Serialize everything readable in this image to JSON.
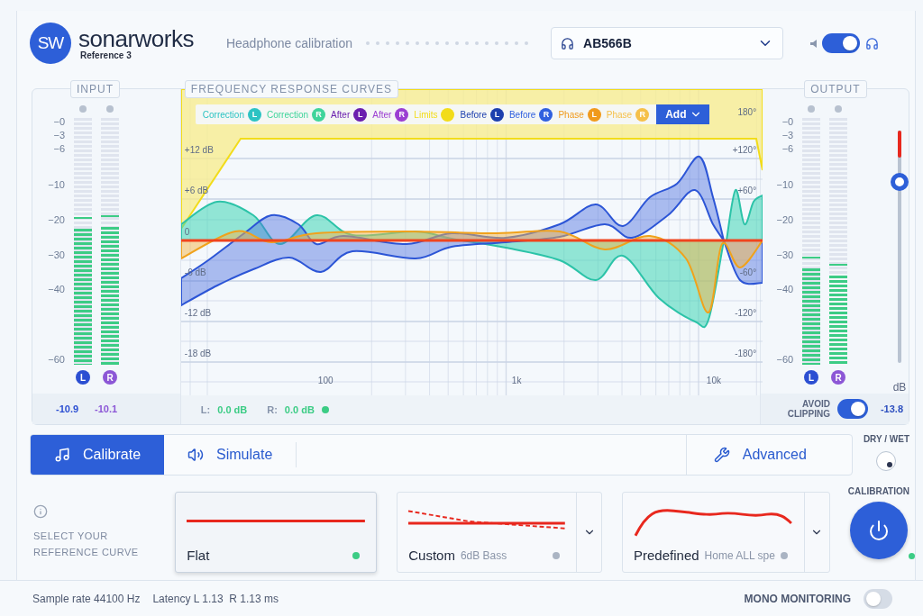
{
  "header": {
    "logo_text": "SW",
    "brand": "sonarworks",
    "product": "Reference 3",
    "mode": "Headphone calibration",
    "device": "AB566B",
    "output_switch": {
      "on": true
    }
  },
  "input": {
    "title": "INPUT",
    "scale": [
      "−0",
      "−3",
      "−6",
      "−10",
      "−20",
      "−30",
      "−40",
      "−60"
    ],
    "channels": [
      {
        "badge": "L",
        "color": "#2c4fd2",
        "level": 0.55,
        "reading": "-10.9"
      },
      {
        "badge": "R",
        "color": "#8c57d6",
        "level": 0.56,
        "reading": "-10.1"
      }
    ]
  },
  "response": {
    "title": "FREQUENCY RESPONSE CURVES",
    "legend": [
      {
        "label": "Correction",
        "badge": "L",
        "color": "#2cc3c3"
      },
      {
        "label": "Correction",
        "badge": "R",
        "color": "#3fd49b"
      },
      {
        "label": "After",
        "badge": "L",
        "color": "#6a1fae"
      },
      {
        "label": "After",
        "badge": "R",
        "color": "#9b3ed2"
      },
      {
        "label": "Limits",
        "color": "#f2dc1a"
      },
      {
        "label": "Before",
        "badge": "L",
        "color": "#1c3fae"
      },
      {
        "label": "Before",
        "badge": "R",
        "color": "#3060df"
      },
      {
        "label": "Phase",
        "badge": "L",
        "color": "#f09a1c"
      },
      {
        "label": "Phase",
        "badge": "R",
        "color": "#f5c04a"
      }
    ],
    "add_button": "Add",
    "db_ticks": [
      "+12 dB",
      "+6 dB",
      "0",
      "-6 dB",
      "-12 dB",
      "-18 dB"
    ],
    "phase_ticks": [
      "180°",
      "+120°",
      "+60°",
      "-60°",
      "-120°",
      "-180°"
    ],
    "freq_ticks": [
      "100",
      "1k",
      "10k"
    ],
    "left": {
      "label": "L:",
      "value": "0.0 dB"
    },
    "right": {
      "label": "R:",
      "value": "0.0 dB"
    },
    "status_on": true
  },
  "output": {
    "title": "OUTPUT",
    "scale": [
      "−0",
      "−3",
      "−6",
      "−10",
      "−20",
      "−30",
      "−40",
      "−60"
    ],
    "channels": [
      {
        "badge": "L",
        "color": "#2c4fd2",
        "level": 0.39
      },
      {
        "badge": "R",
        "color": "#8c57d6",
        "level": 0.36
      }
    ],
    "volume": {
      "level": 0.78,
      "unit": "dB"
    },
    "avoid_clipping": {
      "label": "AVOID CLIPPING",
      "on": true
    },
    "gain": "-13.8"
  },
  "tabs": [
    {
      "label": "Calibrate",
      "selected": true,
      "kind": "note"
    },
    {
      "label": "Simulate",
      "selected": false,
      "kind": "speaker"
    },
    {
      "label": "Advanced",
      "selected": false,
      "kind": "wrench"
    }
  ],
  "dry_wet": {
    "label": "DRY / WET"
  },
  "reference": {
    "prompt": "SELECT YOUR REFERENCE CURVE",
    "curves": [
      {
        "kind": "flat",
        "name": "Flat",
        "selected": true,
        "active": true
      },
      {
        "kind": "custom",
        "name": "Custom",
        "detail": "6dB Bass",
        "selected": false,
        "active": false
      },
      {
        "kind": "predefined",
        "name": "Predefined",
        "detail": "Home ALL spe",
        "selected": false,
        "active": false
      }
    ]
  },
  "calibration": {
    "label": "CALIBRATION",
    "on": true
  },
  "footer": {
    "sample_rate": "Sample rate 44100 Hz",
    "latency": "Latency L 1.13  R 1.13 ms",
    "mono": {
      "label": "MONO MONITORING",
      "on": false
    }
  }
}
